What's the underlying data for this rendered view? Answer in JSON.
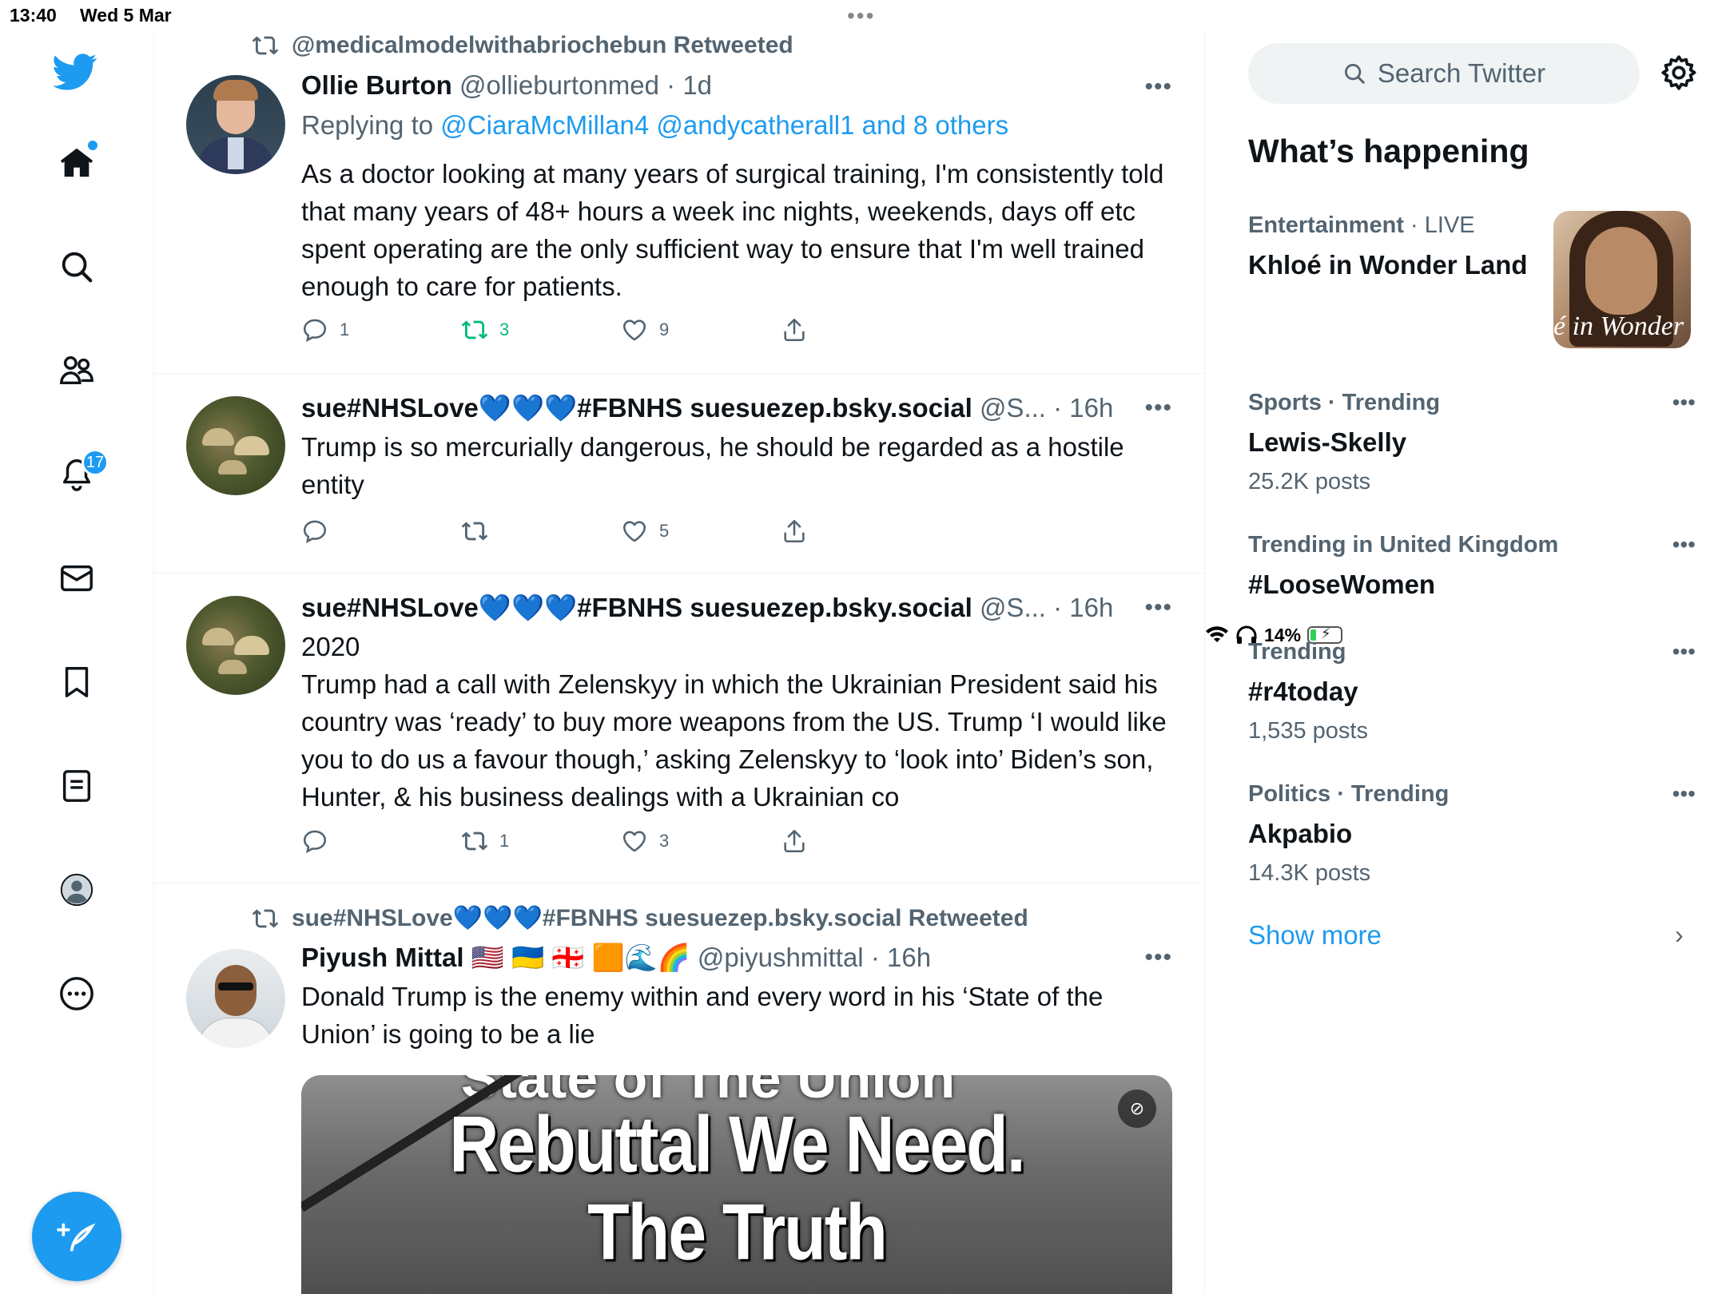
{
  "status_bar": {
    "time": "13:40",
    "date": "Wed 5 Mar",
    "battery": "14%"
  },
  "nav": {
    "notifications_badge": "17"
  },
  "tweets": [
    {
      "retweeted_by": "@medicalmodelwithabriochebun Retweeted",
      "name": "Ollie Burton",
      "handle": "@ollieburtonmed",
      "time": "1d",
      "replying_prefix": "Replying to",
      "replying_links": "@CiaraMcMillan4 @andycatherall1 and 8 others",
      "text": "As a doctor looking at many years of surgical training, I'm consistently told that many years of 48+ hours a week inc nights, weekends, days off etc spent operating are the only sufficient way to ensure that I'm well trained enough to care for patients.",
      "replies": "1",
      "retweets": "3",
      "likes": "9"
    },
    {
      "name": "sue#NHSLove💙💙💙#FBNHS suesuezep.bsky.social",
      "handle": "@S...",
      "time": "16h",
      "text": "Trump is so mercurially dangerous, he should be regarded as a hostile entity",
      "replies": "",
      "retweets": "",
      "likes": "5"
    },
    {
      "name": "sue#NHSLove💙💙💙#FBNHS suesuezep.bsky.social",
      "handle": "@S...",
      "time": "16h",
      "text": "2020\nTrump had a call with Zelenskyy in which the Ukrainian President said his country was ‘ready’ to buy more weapons from the US. Trump  ‘I would like you to do us a favour though,’ asking Zelenskyy to ‘look into’ Biden’s son, Hunter, & his business dealings with a Ukrainian co",
      "replies": "",
      "retweets": "1",
      "likes": "3"
    },
    {
      "retweeted_by": "sue#NHSLove💙💙💙#FBNHS suesuezep.bsky.social Retweeted",
      "name": "Piyush Mittal 🇺🇸 🇺🇦 🇬🇪 🟧🌊🌈",
      "handle": "@piyushmittal",
      "time": "16h",
      "text": "Donald Trump is the enemy within and every word in his ‘State of the Union’ is going to be a lie",
      "media_top": "State of The Union",
      "media_line1": "Rebuttal We Need.",
      "media_line2": "The Truth"
    }
  ],
  "sidebar": {
    "search_placeholder": "Search Twitter",
    "title": "What’s happening",
    "trends": [
      {
        "category": "Entertainment",
        "live": "LIVE",
        "topic": "Khloé in Wonder Land",
        "image_text": "é in Wonder L"
      },
      {
        "category": "Sports · Trending",
        "topic": "Lewis-Skelly",
        "count": "25.2K posts"
      },
      {
        "category": "Trending in United Kingdom",
        "topic": "#LooseWomen",
        "count": ""
      },
      {
        "category": "Trending",
        "topic": "#r4today",
        "count": "1,535 posts"
      },
      {
        "category": "Politics · Trending",
        "topic": "Akpabio",
        "count": "14.3K posts"
      }
    ],
    "show_more": "Show more"
  },
  "colors": {
    "accent": "#1d9bf0",
    "retweet_green": "#00ba7c",
    "secondary_text": "#536471"
  }
}
